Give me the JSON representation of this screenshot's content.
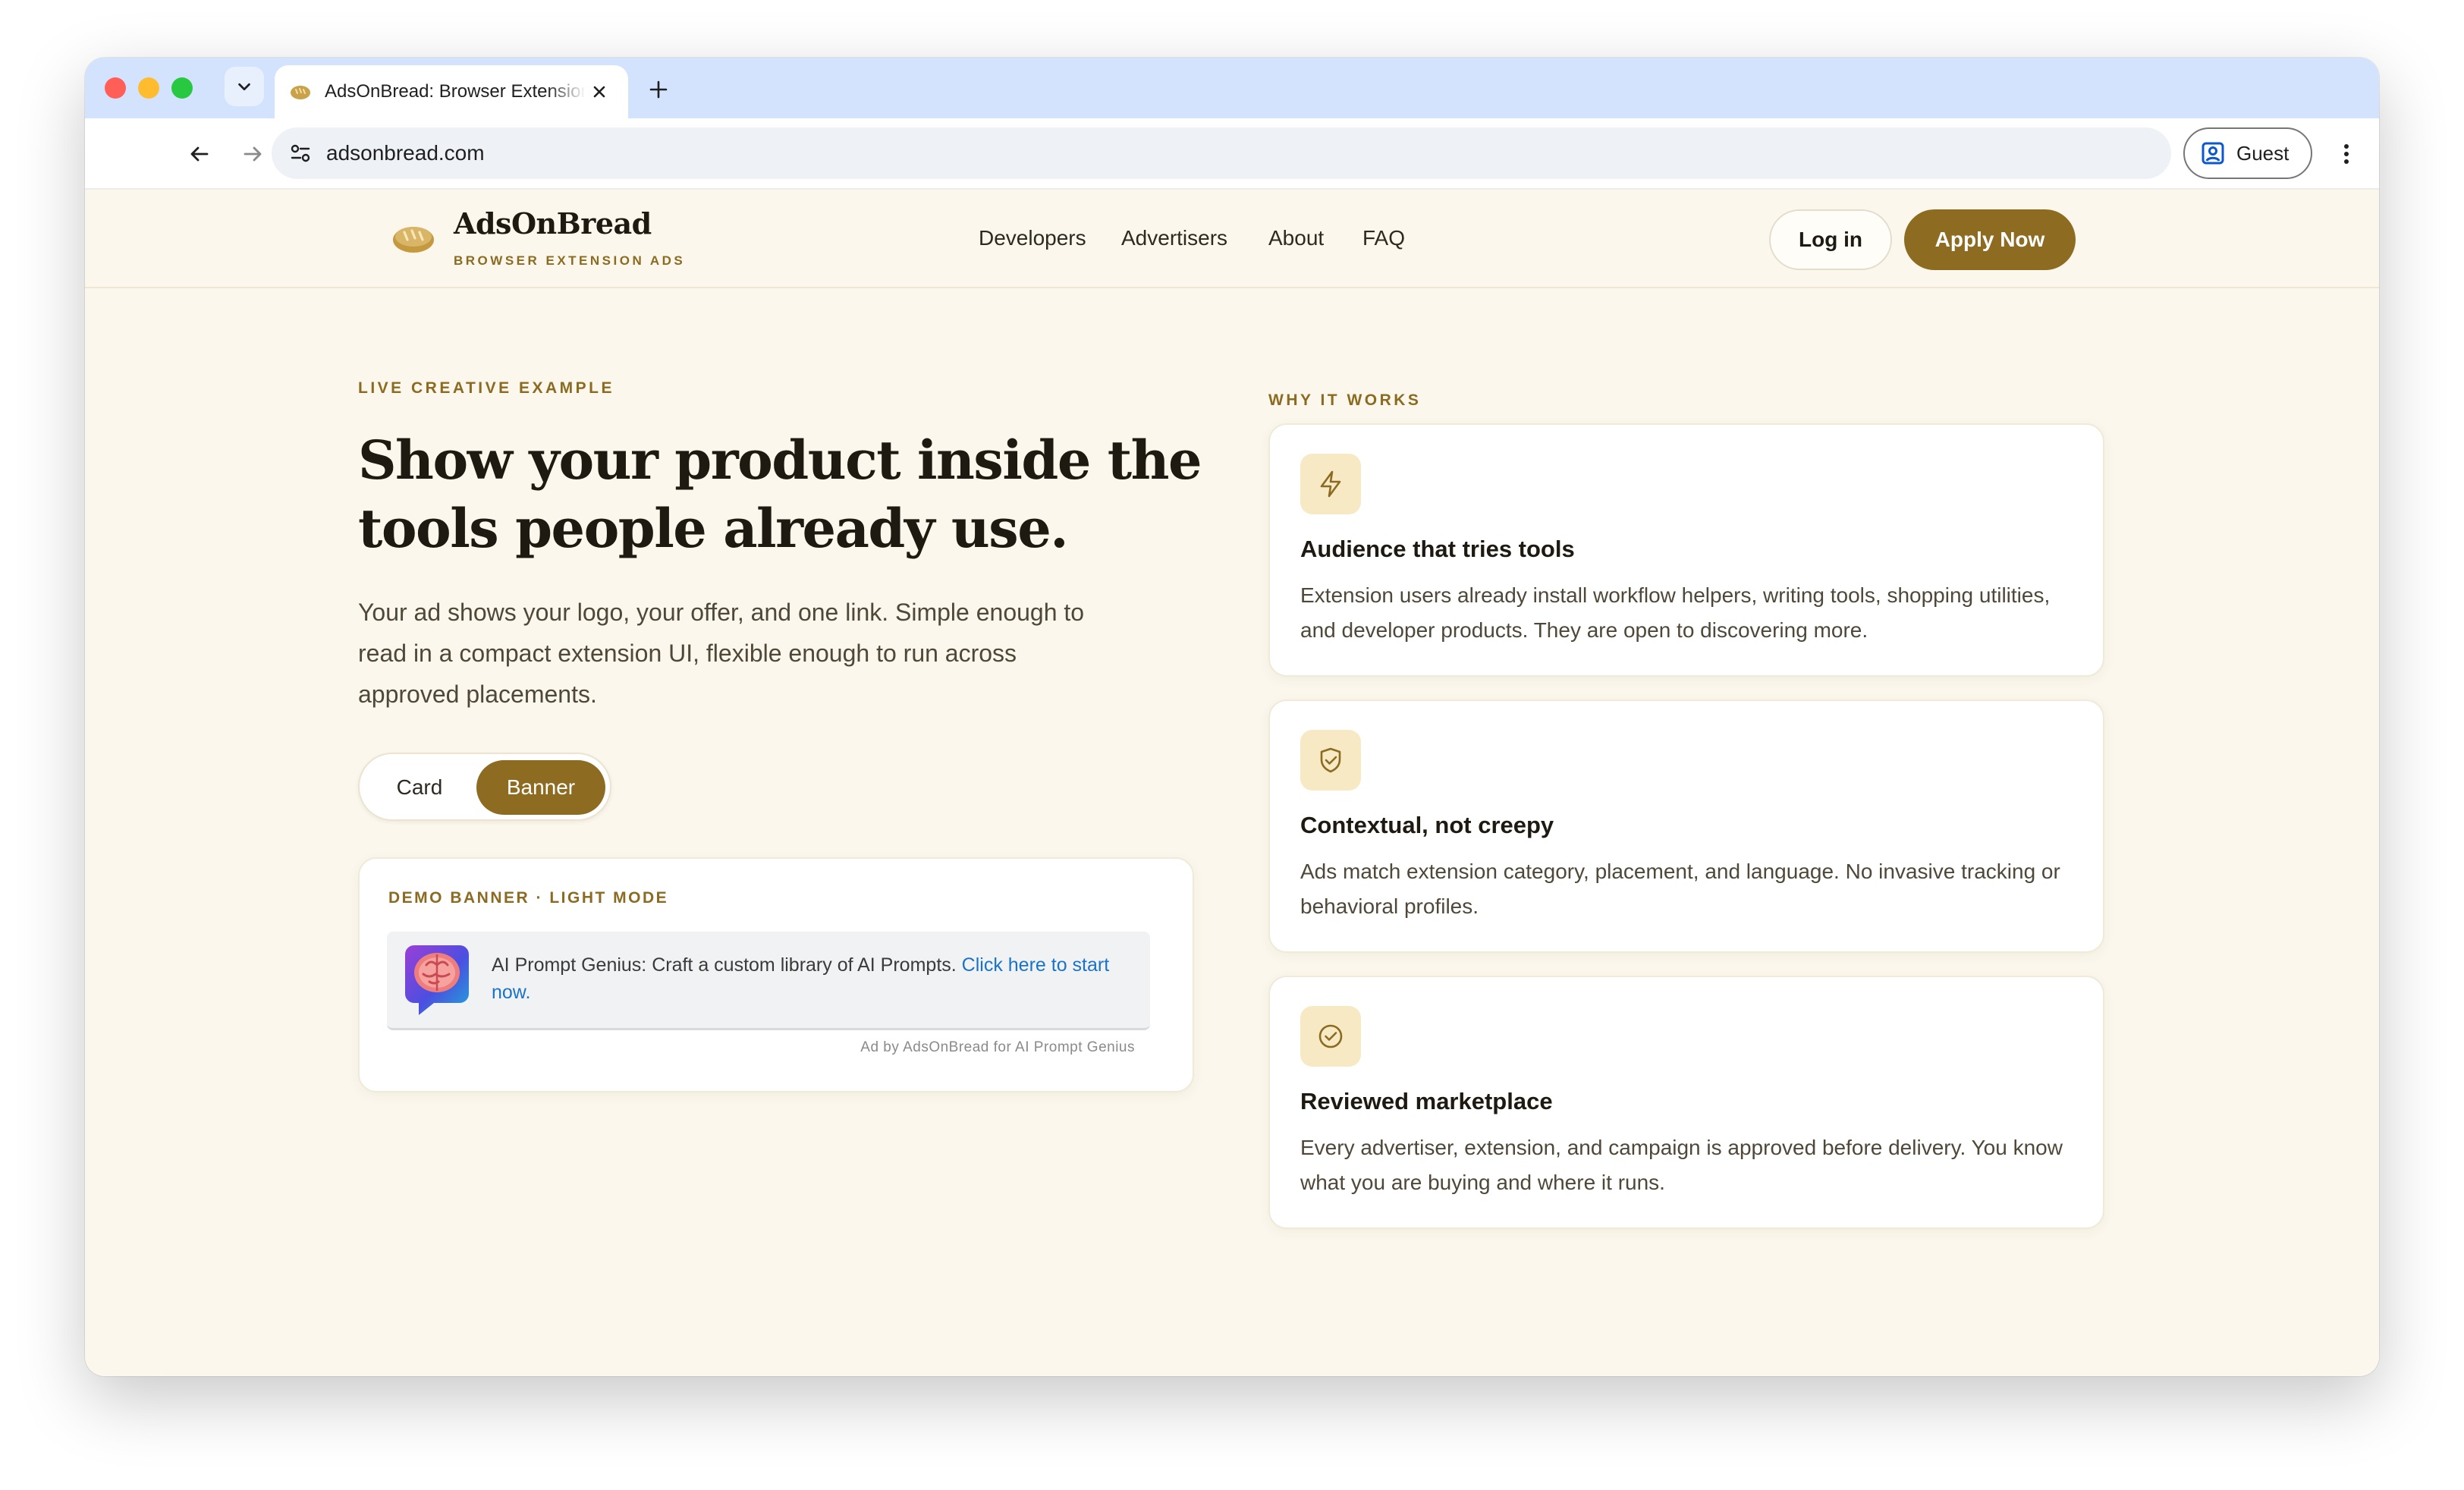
{
  "browser": {
    "tab_title": "AdsOnBread: Browser Extension Ads",
    "url": "adsonbread.com",
    "profile_label": "Guest"
  },
  "header": {
    "brand_name": "AdsOnBread",
    "brand_tagline": "BROWSER EXTENSION ADS",
    "nav": [
      {
        "label": "Developers"
      },
      {
        "label": "Advertisers"
      },
      {
        "label": "About"
      },
      {
        "label": "FAQ"
      }
    ],
    "login_label": "Log in",
    "apply_label": "Apply Now"
  },
  "hero": {
    "eyebrow": "LIVE CREATIVE EXAMPLE",
    "title": "Show your product inside the tools people already use.",
    "description": "Your ad shows your logo, your offer, and one link. Simple enough to read in a compact extension UI, flexible enough to run across approved placements.",
    "toggle": {
      "options": [
        "Card",
        "Banner"
      ],
      "selected": "Banner"
    }
  },
  "demo": {
    "label": "DEMO BANNER · LIGHT MODE",
    "ad_text": "AI Prompt Genius: Craft a custom library of AI Prompts.",
    "ad_link": "Click here to start now.",
    "attribution": "Ad by AdsOnBread for AI Prompt Genius"
  },
  "why": {
    "eyebrow": "WHY IT WORKS",
    "features": [
      {
        "icon": "lightning-icon",
        "title": "Audience that tries tools",
        "description": "Extension users already install workflow helpers, writing tools, shopping utilities, and developer products. They are open to discovering more."
      },
      {
        "icon": "shield-check-icon",
        "title": "Contextual, not creepy",
        "description": "Ads match extension category, placement, and language. No invasive tracking or behavioral profiles."
      },
      {
        "icon": "check-circle-icon",
        "title": "Reviewed marketplace",
        "description": "Every advertiser, extension, and campaign is approved before delivery. You know what you are buying and where it runs."
      }
    ]
  },
  "colors": {
    "accent": "#8d6c22",
    "page_background": "#fbf7ec",
    "icon_tile": "#f7e9c4",
    "link": "#1a73c8"
  }
}
